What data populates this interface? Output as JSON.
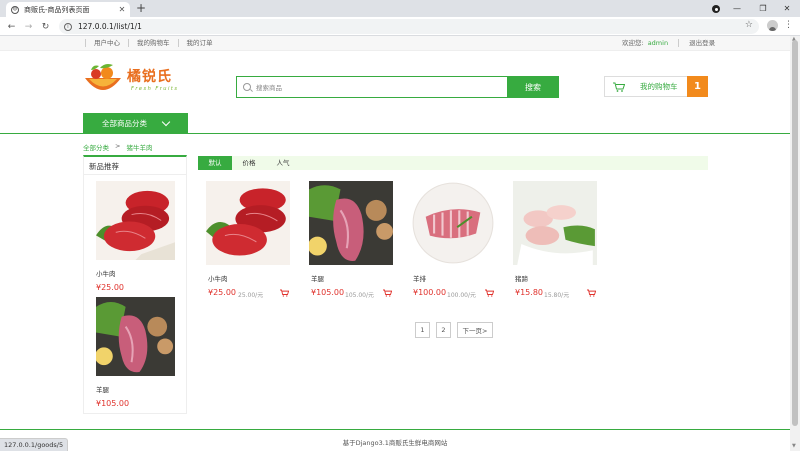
{
  "browser": {
    "tab_title": "商贩氏-商品列表页面",
    "url": "127.0.0.1/list/1/1",
    "status_url": "127.0.0.1/goods/5"
  },
  "topbar": {
    "links": [
      "用户中心",
      "我的购物车",
      "我的订单"
    ],
    "welcome": "欢迎您:",
    "username": "admin",
    "logout": "退出登录"
  },
  "logo": {
    "text": "橘锐氏",
    "sub": "Fresh Fruits"
  },
  "search": {
    "placeholder": "搜索商品",
    "button": "搜索"
  },
  "cart": {
    "label": "我的购物车",
    "count": "1"
  },
  "category_button": "全部商品分类",
  "breadcrumb": {
    "root": "全部分类",
    "sep": ">",
    "current": "猪牛羊肉"
  },
  "sidebar": {
    "title": "新品推荐",
    "items": [
      {
        "name": "小牛肉",
        "price": "¥25.00",
        "image": "beef"
      },
      {
        "name": "羊腿",
        "price": "¥105.00",
        "image": "lamb-leg"
      }
    ]
  },
  "sort": [
    "默认",
    "价格",
    "人气"
  ],
  "goods": [
    {
      "name": "小牛肉",
      "price": "¥25.00",
      "unit": "25.00/元",
      "image": "beef"
    },
    {
      "name": "羊腿",
      "price": "¥105.00",
      "unit": "105.00/元",
      "image": "lamb-leg"
    },
    {
      "name": "羊排",
      "price": "¥100.00",
      "unit": "100.00/元",
      "image": "lamb-rack"
    },
    {
      "name": "猪蹄",
      "price": "¥15.80",
      "unit": "15.80/元",
      "image": "pig-trotters"
    }
  ],
  "pager": [
    "1",
    "2",
    "下一页>"
  ],
  "footer": "基于Django3.1商贩氏生鲜电商网站",
  "colors": {
    "brand_green": "#37ab40",
    "price_red": "#e0322c",
    "accent_orange": "#f28a1c"
  }
}
